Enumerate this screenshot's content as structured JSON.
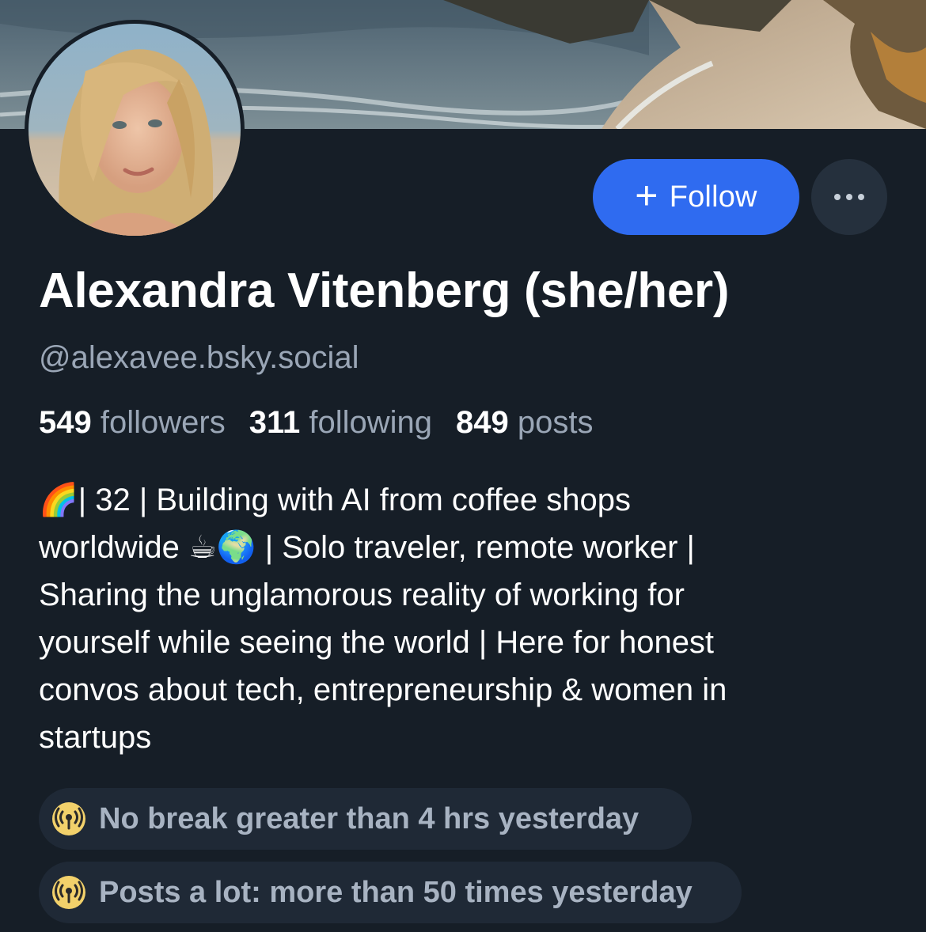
{
  "profile": {
    "display_name": "Alexandra Vitenberg (she/her)",
    "handle": "@alexavee.bsky.social",
    "banner_icon": "coastal-beach-photo",
    "avatar_icon": "profile-photo"
  },
  "actions": {
    "follow_label": "Follow",
    "follow_icon": "plus-icon",
    "more_icon": "ellipsis-icon",
    "accent_color": "#2f6bf0"
  },
  "stats": {
    "followers_count": "549",
    "followers_label": "followers",
    "following_count": "311",
    "following_label": "following",
    "posts_count": "849",
    "posts_label": "posts"
  },
  "bio": {
    "line1": "🌈| 32 | Building with AI from coffee shops",
    "line2": "worldwide ☕🌍 | Solo traveler, remote worker |",
    "line3": "Sharing the unglamorous reality of working for",
    "line4": "yourself while seeing the world | Here for honest",
    "line5": "convos about tech, entrepreneurship & women in",
    "line6": "startups"
  },
  "labels": [
    {
      "text": "No break greater than 4 hrs yesterday",
      "icon": "broadcast-icon"
    },
    {
      "text": "Posts a lot: more than 50 times yesterday",
      "icon": "broadcast-icon"
    }
  ]
}
